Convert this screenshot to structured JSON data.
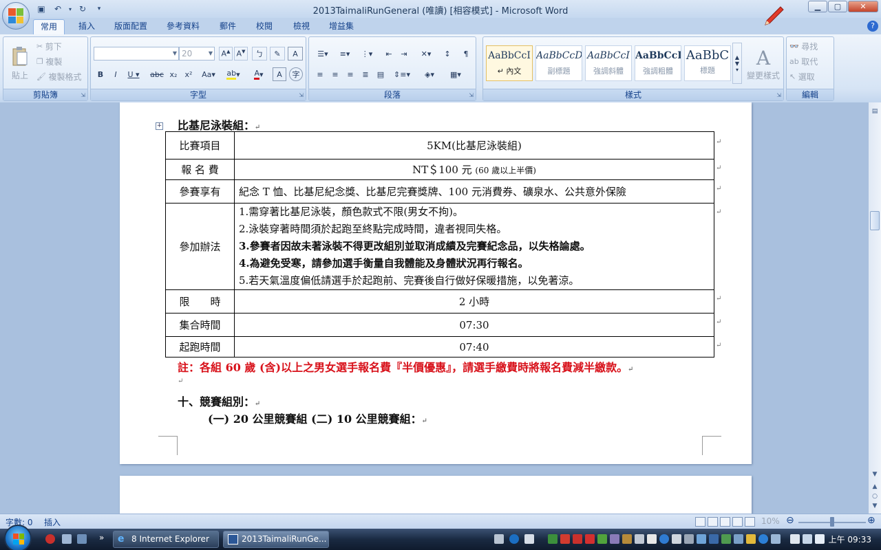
{
  "window": {
    "title": "2013TaimaliRunGeneral (唯讀) [相容模式] - Microsoft Word"
  },
  "ribbon_tabs": [
    "常用",
    "插入",
    "版面配置",
    "參考資料",
    "郵件",
    "校閱",
    "檢視",
    "增益集"
  ],
  "ribbon": {
    "clipboard": {
      "label": "剪貼簿",
      "paste": "貼上",
      "cut": "剪下",
      "copy": "複製",
      "format_painter": "複製格式"
    },
    "font": {
      "label": "字型",
      "font_name": "",
      "font_size": "20"
    },
    "paragraph": {
      "label": "段落"
    },
    "styles": {
      "label": "樣式",
      "items": [
        {
          "sample": "AaBbCcI",
          "name": "↵ 內文"
        },
        {
          "sample": "AaBbCcD",
          "name": "副標題"
        },
        {
          "sample": "AaBbCcI",
          "name": "強調斜體"
        },
        {
          "sample": "AaBbCcI",
          "name": "強調粗體"
        },
        {
          "sample": "AaBbC",
          "name": "標題"
        }
      ],
      "change_styles": "變更樣式"
    },
    "editing": {
      "label": "編輯",
      "find": "尋找",
      "replace": "取代",
      "select": "選取"
    }
  },
  "document": {
    "heading": "比基尼泳裝組：",
    "table": {
      "event": {
        "label": "比賽項目",
        "value": "5KM(比基尼泳裝組)"
      },
      "fee": {
        "label": "報 名 費",
        "value": "NT＄100 元",
        "value_small": "(60 歲以上半價)"
      },
      "benefits": {
        "label": "參賽享有",
        "value": "紀念 T 恤、比基尼紀念獎、比基尼完賽獎牌、100 元消費券、礦泉水、公共意外保險"
      },
      "rules": {
        "label": "參加辦法",
        "items": [
          "1.需穿著比基尼泳裝，顏色款式不限(男女不拘)。",
          "2.泳裝穿著時間須於起跑至終點完成時間，違者視同失格。",
          "3.參賽者因故未著泳裝不得更改組別並取消成績及完賽紀念品，以失格論處。",
          "4.為避免受寒，請參加選手衡量自我體能及身體狀況再行報名。",
          "5.若天氣溫度偏低請選手於起跑前、完賽後自行做好保暖措施，以免著涼。"
        ]
      },
      "time_limit": {
        "label": "限　　時",
        "value": "2 小時"
      },
      "assembly": {
        "label": "集合時間",
        "value": "07:30"
      },
      "start": {
        "label": "起跑時間",
        "value": "07:40"
      }
    },
    "note": "註：各組 60 歲 (含)以上之男女選手報名費『半價優惠』，請選手繳費時將報名費減半繳款。",
    "section10": "十、競賽組別：",
    "section10_sub": "(一) 20 公里競賽組 (二) 10 公里競賽組："
  },
  "statusbar": {
    "word_count": "字數: 0",
    "mode": "插入",
    "zoom": "10%"
  },
  "taskbar": {
    "tasks": [
      {
        "label": "8 Internet Explorer"
      },
      {
        "label": "2013TaimaliRunGe..."
      }
    ],
    "clock": "上午 09:33"
  }
}
